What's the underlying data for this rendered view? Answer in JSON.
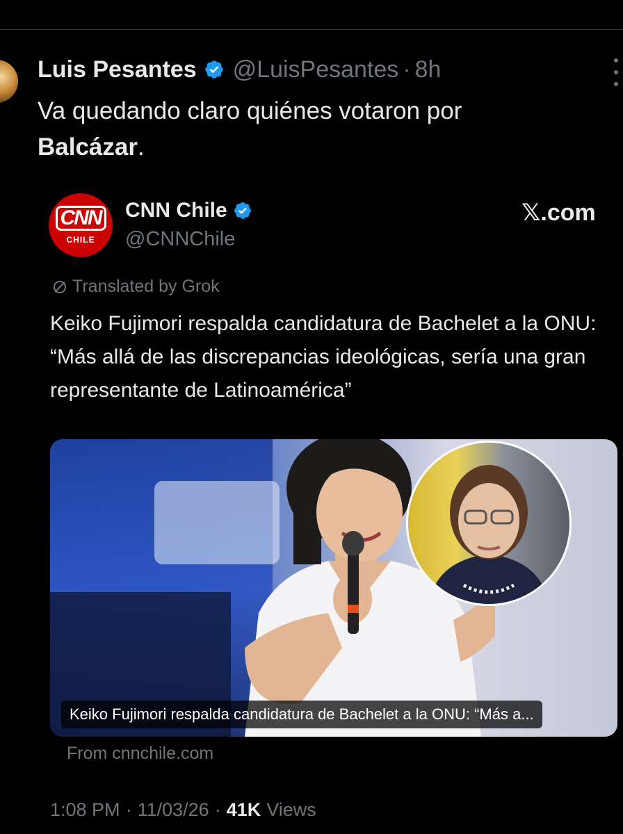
{
  "tweet": {
    "author_name": "Luis Pesantes",
    "handle": "@LuisPesantes",
    "separator": "·",
    "time": "8h",
    "text_part1": "Va quedando claro quiénes votaron por",
    "text_bold": "Balcázar",
    "text_end": "."
  },
  "quoted": {
    "source_name": "CNN Chile",
    "source_handle": "@CNNChile",
    "logo_main": "CNN",
    "logo_sub": "CHILE",
    "site_brand": "𝕏.com",
    "translated_label": "Translated by Grok",
    "text": "Keiko Fujimori respalda candidatura de Bachelet a la ONU: “Más allá de las discrepancias ideológicas, sería una gran representante de Latinoamérica”",
    "media_caption": "Keiko Fujimori respalda candidatura de Bachelet a la ONU: “Más a...",
    "from_site": "From cnnchile.com"
  },
  "meta": {
    "time": "1:08 PM",
    "date": "11/03/26",
    "separator": "·",
    "views_count": "41K",
    "views_label": "Views"
  },
  "colors": {
    "background": "#000000",
    "text_primary": "#e7e9ea",
    "text_secondary": "#71767b",
    "verified_blue": "#1d9bf0",
    "cnn_red": "#cc0000"
  }
}
